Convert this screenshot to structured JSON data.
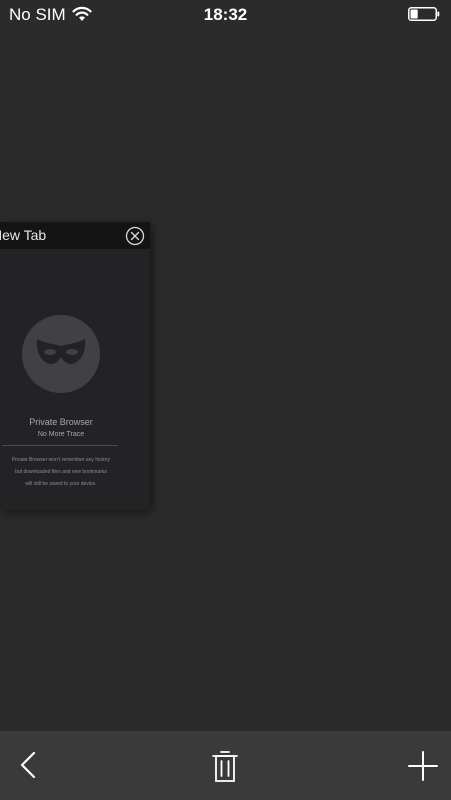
{
  "status_bar": {
    "carrier": "No SIM",
    "time": "18:32",
    "battery_level": 0.3
  },
  "tab": {
    "title": "New Tab",
    "private": {
      "title": "Private Browser",
      "subtitle": "No More Trace",
      "desc_line1": "Private Browser won’t remember any history",
      "desc_line2": "but downloaded files and new bookmarks",
      "desc_line3": "will still be saved to your device."
    }
  },
  "toolbar": {
    "back_icon": "chevron-left-icon",
    "trash_icon": "trash-icon",
    "add_icon": "plus-icon"
  },
  "colors": {
    "background": "#2b2b2b",
    "toolbar": "#3a3a3a",
    "tab_header": "#141414",
    "tab_body": "#232326"
  }
}
